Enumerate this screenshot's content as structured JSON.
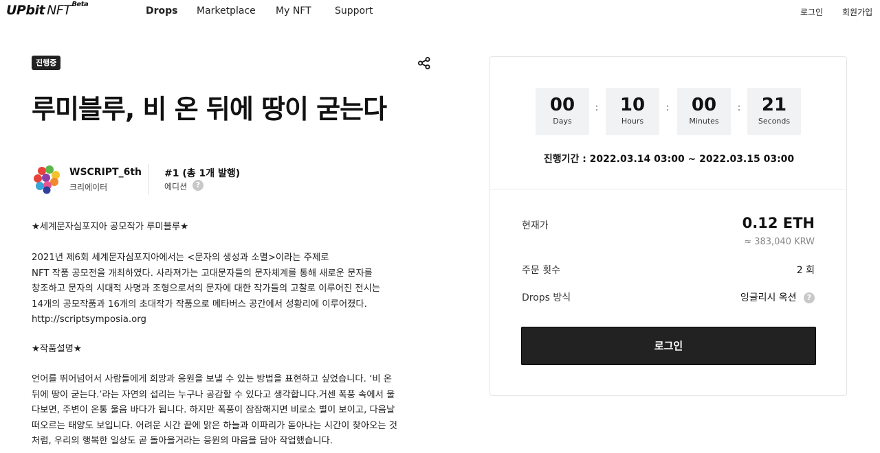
{
  "header": {
    "logo_main": "UPbit",
    "logo_nft": "NFT",
    "logo_beta": "Beta",
    "nav": [
      "Drops",
      "Marketplace",
      "My NFT",
      "Support"
    ],
    "login": "로그인",
    "signup": "회원가입"
  },
  "drop": {
    "status_badge": "진행중",
    "title": "루미블루, 비 온 뒤에 땅이 굳는다",
    "creator_name": "WSCRIPT_6th",
    "creator_role": "크리에이터",
    "edition_number": "#1 (총 1개 발행)",
    "edition_label": "에디션",
    "help_glyph": "?"
  },
  "description": {
    "heading1": "★세계문자심포지아 공모작가 루미블루★",
    "para1": [
      "2021년 제6회 세계문자심포지아에서는 <문자의 생성과 소멸>이라는 주제로",
      "NFT 작품 공모전을 개최하였다. 사라져가는 고대문자들의 문자체계를 통해 새로운 문자를",
      "창조하고 문자의 시대적 사명과 조형으로서의 문자에 대한 작가들의 고찰로 이루어진 전시는",
      "14개의 공모작품과 16개의 초대작가 작품으로 메타버스 공간에서 성황리에 이루어졌다.",
      "http://scriptsymposia.org"
    ],
    "heading2": "★작품설명★",
    "para2": [
      "언어를 뛰어넘어서 사람들에게 희망과 응원을 보낼 수 있는 방법을 표현하고 싶었습니다. ‘비 온",
      "뒤에 땅이 굳는다.’라는 자연의 섭리는 누구나 공감할 수 있다고 생각합니다.거센 폭풍 속에서 울",
      "다보면, 주변이 온통 울음 바다가 됩니다. 하지만 폭풍이 잠잠해지면 비로소 별이 보이고, 다음날",
      "떠오르는 태양도 보입니다. 어려운 시간 끝에 맑은 하늘과 이파리가 돋아나는 시간이 찾아오는 것",
      "처럼, 우리의 행복한 일상도 곧 돌아올거라는 응원의 마음을 담아 작업했습니다."
    ]
  },
  "countdown": {
    "days": "00",
    "days_label": "Days",
    "hours": "10",
    "hours_label": "Hours",
    "minutes": "00",
    "minutes_label": "Minutes",
    "seconds": "21",
    "seconds_label": "Seconds",
    "separator": ":"
  },
  "period": "진행기간 : 2022.03.14 03:00 ~ 2022.03.15 03:00",
  "info": {
    "price_label": "현재가",
    "price_value": "0.12 ETH",
    "price_krw": "≈ 383,040 KRW",
    "orders_label": "주문 횟수",
    "orders_value": "2 회",
    "method_label": "Drops 방식",
    "method_value": "잉글리시 옥션"
  },
  "login_button": "로그인",
  "icons": {
    "share": "share-icon",
    "help": "question-icon"
  },
  "colors": {
    "primary_dark": "#222222",
    "countdown_bg": "#f1f2f4",
    "muted_text": "#888888"
  }
}
